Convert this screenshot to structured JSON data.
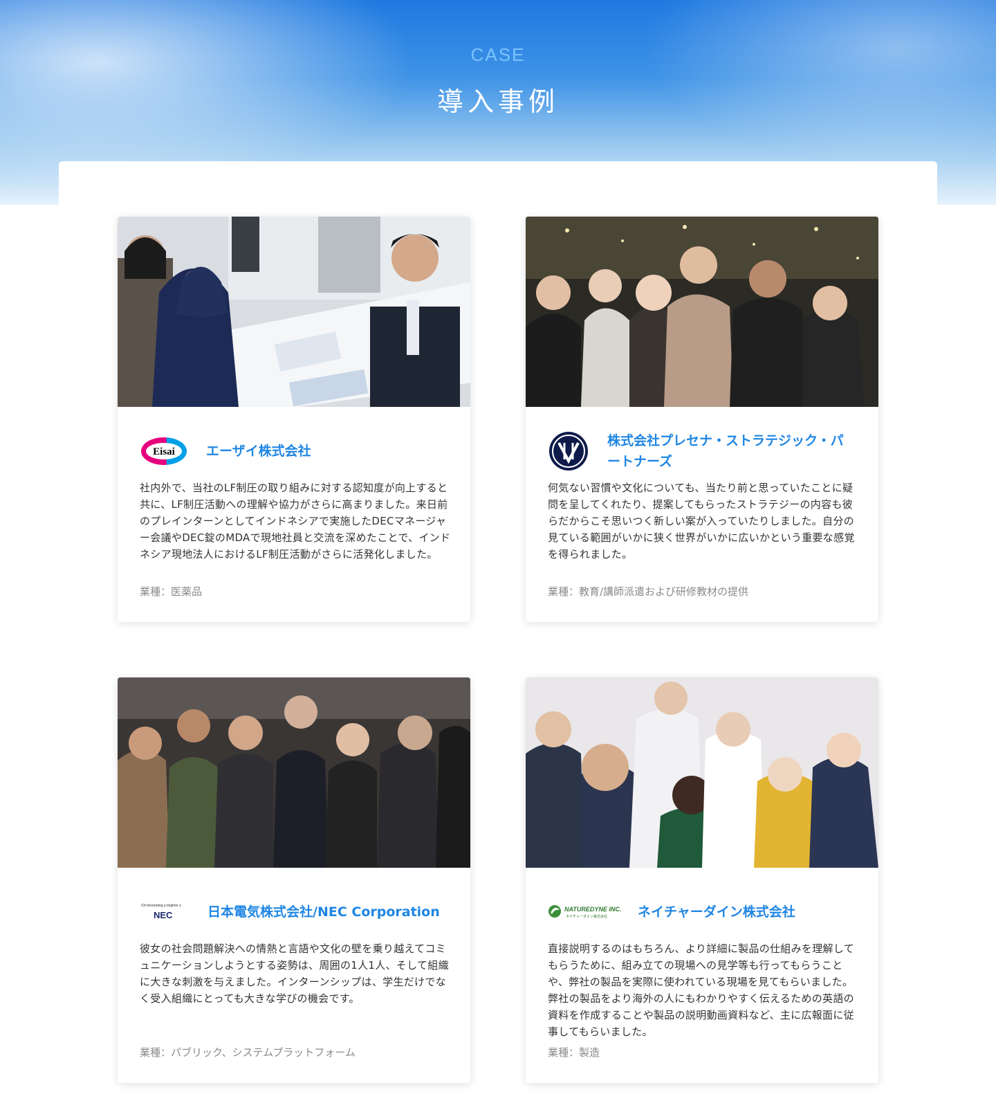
{
  "header": {
    "label": "CASE",
    "title": "導入事例"
  },
  "cases": [
    {
      "company": "エーザイ株式会社",
      "logo_text": "Eisai",
      "description": "社内外で、当社のLF制圧の取り組みに対する認知度が向上すると共に、LF制圧活動への理解や協力がさらに高まりました。来日前のプレインターンとしてインドネシアで実施したDECマネージャー会議やDEC錠のMDAで現地社員と交流を深めたことで、インドネシア現地法人におけるLF制圧活動がさらに活発化しました。",
      "industry": "業種：医薬品"
    },
    {
      "company": "株式会社プレセナ・ストラテジック・パートナーズ",
      "description": "何気ない習慣や文化についても、当たり前と思っていたことに疑問を呈してくれたり、提案してもらったストラテジーの内容も彼らだからこそ思いつく新しい案が入っていたりしました。自分の見ている範囲がいかに狭く世界がいかに広いかという重要な感覚を得られました。",
      "industry": "業種：教育/講師派遣および研修教材の提供"
    },
    {
      "company": "日本電気株式会社/NEC Corporation",
      "logo_text": "NEC",
      "logo_tagline": "\\Orchestrating a brighter world",
      "description": "彼女の社会問題解決への情熱と言語や文化の壁を乗り越えてコミュニケーションしようとする姿勢は、周囲の1人1人、そして組織に大きな刺激を与えました。インターンシップは、学生だけでなく受入組織にとっても大きな学びの機会です。",
      "industry": "業種：パブリック、システムプラットフォーム"
    },
    {
      "company": "ネイチャーダイン株式会社",
      "logo_text": "NATUREDYNE INC.",
      "logo_subtext": "ネイチャーダイン株式会社",
      "description": "直接説明するのはもちろん、より詳細に製品の仕組みを理解してもらうために、組み立ての現場への見学等も行ってもらうことや、弊社の製品を実際に使われている現場を見てもらいました。弊社の製品をより海外の人にもわかりやすく伝えるための英語の資料を作成することや製品の説明動画資料など、主に広報面に従事してもらいました。",
      "industry": "業種：製造"
    }
  ],
  "colors": {
    "accent": "#1f86e3",
    "hero_top": "#1f79e0",
    "muted_text": "#8a8a8a"
  }
}
